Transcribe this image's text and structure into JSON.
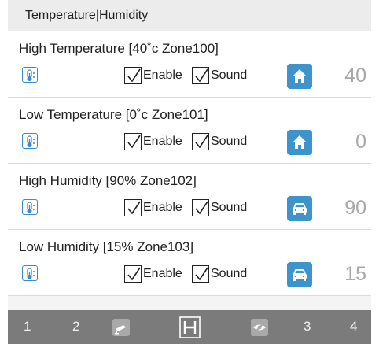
{
  "header": {
    "title": "Temperature|Humidity"
  },
  "sections": [
    {
      "title": "High Temperature [40˚c Zone100]",
      "enable_label": "Enable",
      "sound_label": "Sound",
      "enable_checked": true,
      "sound_checked": true,
      "zone_icon": "home-icon",
      "value": "40"
    },
    {
      "title": "Low Temperature [0˚c Zone101]",
      "enable_label": "Enable",
      "sound_label": "Sound",
      "enable_checked": true,
      "sound_checked": true,
      "zone_icon": "home-icon",
      "value": "0"
    },
    {
      "title": "High Humidity [90% Zone102]",
      "enable_label": "Enable",
      "sound_label": "Sound",
      "enable_checked": true,
      "sound_checked": true,
      "zone_icon": "car-icon",
      "value": "90"
    },
    {
      "title": "Low Humidity [15% Zone103]",
      "enable_label": "Enable",
      "sound_label": "Sound",
      "enable_checked": true,
      "sound_checked": true,
      "zone_icon": "car-icon",
      "value": "15"
    }
  ],
  "bottom_nav": {
    "item1": "1",
    "item2": "2",
    "item3": "3",
    "item4": "4",
    "icons": [
      "camera-icon",
      "h-logo-icon",
      "eye-slash-icon"
    ]
  },
  "colors": {
    "accent": "#3d93cc",
    "header_bg": "#ececec",
    "bottom_bar": "#7b7b7b",
    "value_text": "#a8a8a8"
  }
}
